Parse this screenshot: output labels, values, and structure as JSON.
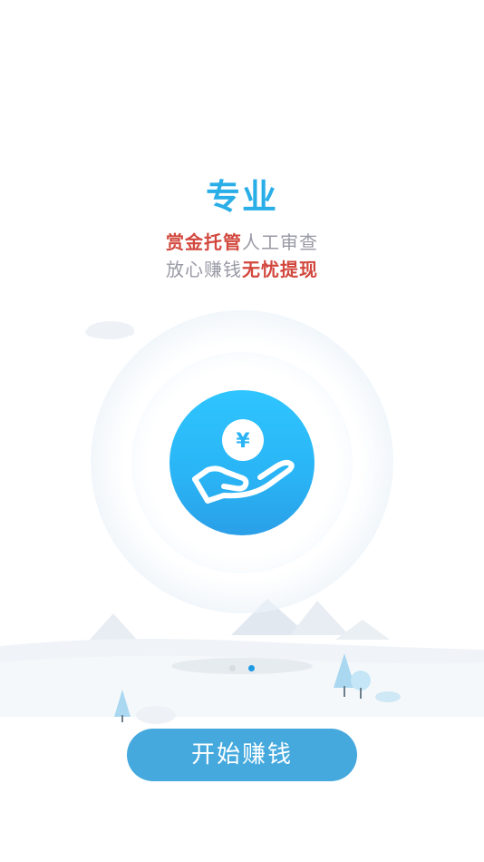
{
  "slide": {
    "title": "专业",
    "line1_highlight": "赏金托管",
    "line1_plain": "人工审查",
    "line2_plain": "放心赚钱",
    "line2_highlight": "无忧提现",
    "coin_symbol": "¥"
  },
  "pager": {
    "total": 2,
    "active": 2
  },
  "cta": {
    "label": "开始赚钱"
  },
  "colors": {
    "title": "#2aaee8",
    "highlight": "#d2483e",
    "plain_text": "#9a9aa6",
    "circle": "#2ab4f5",
    "button": "#45a9dd",
    "active_dot": "#1e9be3",
    "inactive_dot": "#d7dce2"
  },
  "icons": {
    "hero": "hand-holding-coin-icon",
    "scenery": [
      "mountain-icon",
      "tree-icon",
      "cloud-icon"
    ]
  }
}
